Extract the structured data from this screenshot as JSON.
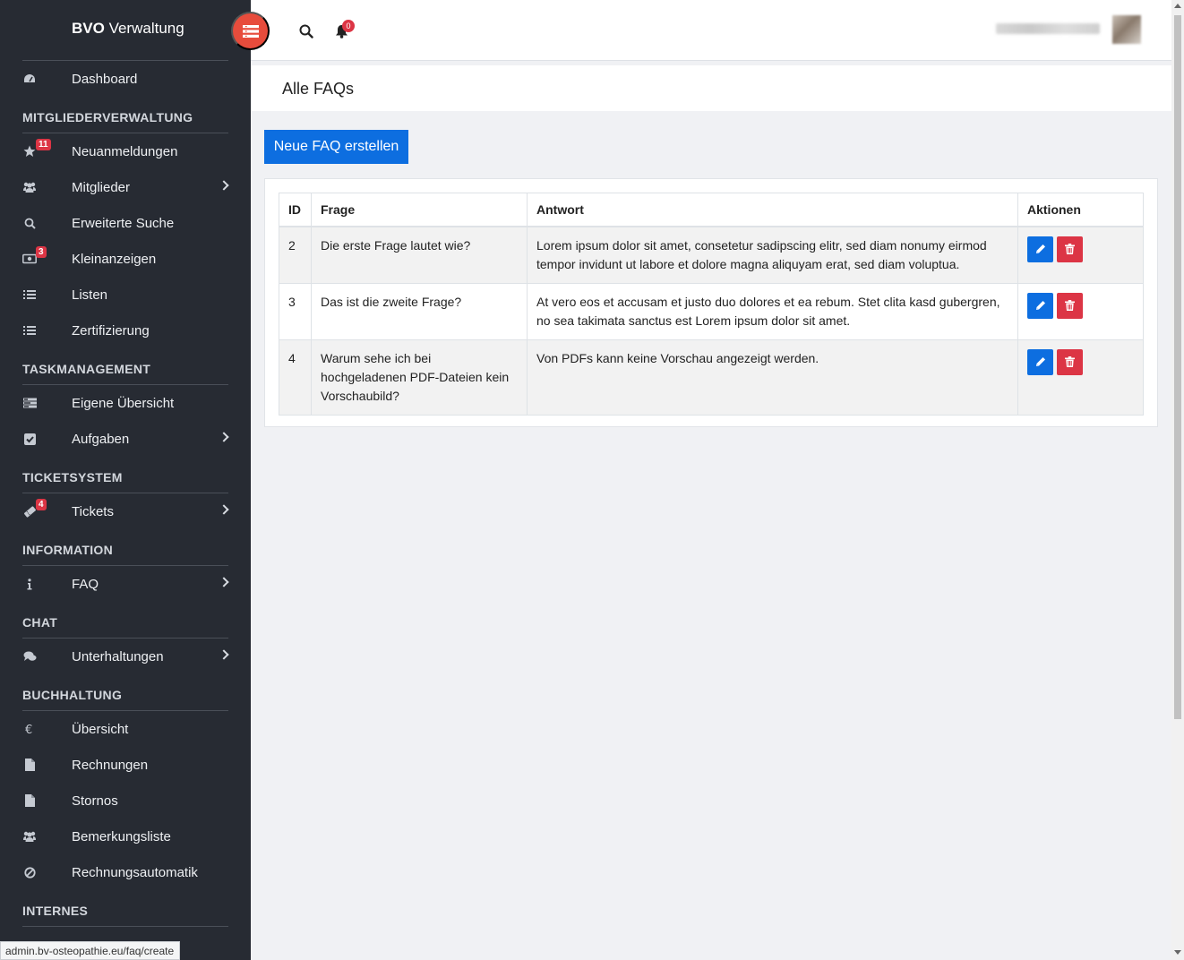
{
  "brand": {
    "bold": "BVO",
    "rest": " Verwaltung"
  },
  "sidebar": {
    "groups": [
      {
        "items": [
          {
            "label": "Dashboard",
            "icon": "dashboard-icon",
            "chevron": false
          }
        ]
      },
      {
        "title": "MITGLIEDERVERWALTUNG",
        "items": [
          {
            "label": "Neuanmeldungen",
            "icon": "star-icon",
            "badge": "11"
          },
          {
            "label": "Mitglieder",
            "icon": "users-icon",
            "chevron": true
          },
          {
            "label": "Erweiterte Suche",
            "icon": "search-icon"
          },
          {
            "label": "Kleinanzeigen",
            "icon": "ad-icon",
            "badge": "3"
          },
          {
            "label": "Listen",
            "icon": "list-icon"
          },
          {
            "label": "Zertifizierung",
            "icon": "list-icon"
          }
        ]
      },
      {
        "title": "TASKMANAGEMENT",
        "items": [
          {
            "label": "Eigene Übersicht",
            "icon": "tasks-icon"
          },
          {
            "label": "Aufgaben",
            "icon": "check-square-icon",
            "chevron": true
          }
        ]
      },
      {
        "title": "TICKETSYSTEM",
        "items": [
          {
            "label": "Tickets",
            "icon": "ticket-icon",
            "badge": "4",
            "chevron": true
          }
        ]
      },
      {
        "title": "INFORMATION",
        "items": [
          {
            "label": "FAQ",
            "icon": "info-icon",
            "chevron": true
          }
        ]
      },
      {
        "title": "CHAT",
        "items": [
          {
            "label": "Unterhaltungen",
            "icon": "comments-icon",
            "chevron": true
          }
        ]
      },
      {
        "title": "BUCHHALTUNG",
        "items": [
          {
            "label": "Übersicht",
            "icon": "euro-icon"
          },
          {
            "label": "Rechnungen",
            "icon": "file-icon"
          },
          {
            "label": "Stornos",
            "icon": "file-icon"
          },
          {
            "label": "Bemerkungsliste",
            "icon": "users-icon"
          },
          {
            "label": "Rechnungsautomatik",
            "icon": "ban-icon"
          }
        ]
      },
      {
        "title": "INTERNES",
        "items": []
      }
    ]
  },
  "topbar": {
    "notifications": "0"
  },
  "page": {
    "title": "Alle FAQs",
    "new_button": "Neue FAQ erstellen"
  },
  "table": {
    "headers": [
      "ID",
      "Frage",
      "Antwort",
      "Aktionen"
    ],
    "rows": [
      {
        "id": "2",
        "frage": "Die erste Frage lautet wie?",
        "antwort": "Lorem ipsum dolor sit amet, consetetur sadipscing elitr, sed diam nonumy eirmod tempor invidunt ut labore et dolore magna aliquyam erat, sed diam voluptua."
      },
      {
        "id": "3",
        "frage": "Das ist die zweite Frage?",
        "antwort": "At vero eos et accusam et justo duo dolores et ea rebum. Stet clita kasd gubergren, no sea takimata sanctus est Lorem ipsum dolor sit amet."
      },
      {
        "id": "4",
        "frage": "Warum sehe ich bei hochgeladenen PDF-Dateien kein Vorschaubild?",
        "antwort": "Von PDFs kann keine Vorschau angezeigt werden."
      }
    ]
  },
  "status_url": "admin.bv-osteopathie.eu/faq/create",
  "colors": {
    "sidebar": "#272b33",
    "primary": "#0d6ee0",
    "danger": "#dc3545",
    "toggle": "#e74c3c"
  }
}
